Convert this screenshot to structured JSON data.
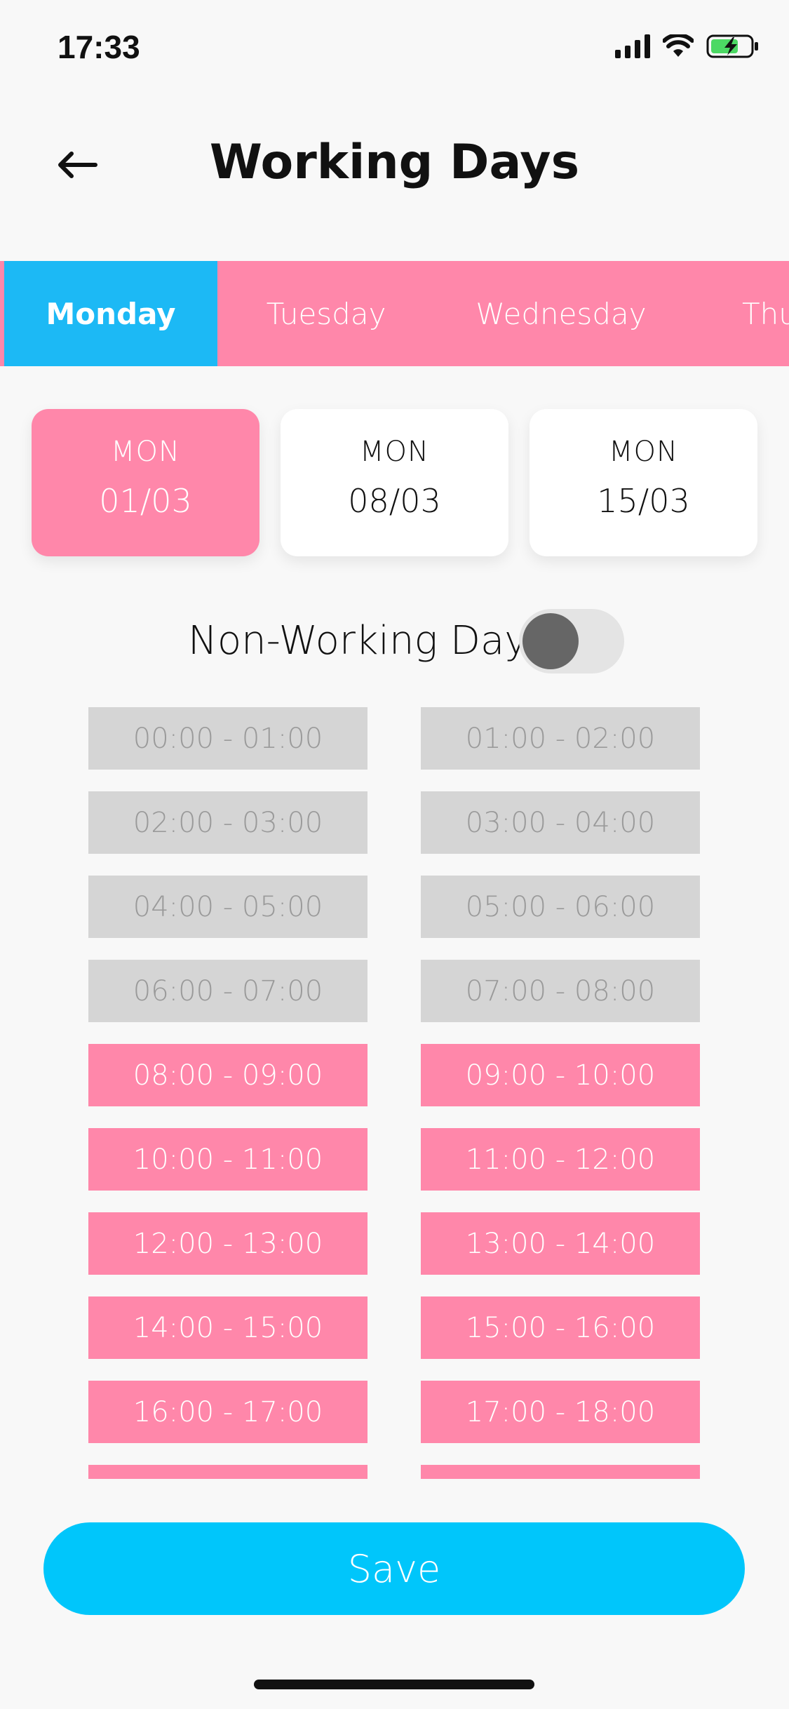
{
  "status_bar": {
    "time": "17:33"
  },
  "header": {
    "title": "Working Days",
    "back_icon": "arrow-left-icon"
  },
  "day_tabs": [
    {
      "label": "Monday",
      "active": true
    },
    {
      "label": "Tuesday",
      "active": false
    },
    {
      "label": "Wednesday",
      "active": false
    },
    {
      "label": "Thu",
      "active": false
    }
  ],
  "date_cards": [
    {
      "dow": "MON",
      "date": "01/03",
      "active": true
    },
    {
      "dow": "MON",
      "date": "08/03",
      "active": false
    },
    {
      "dow": "MON",
      "date": "15/03",
      "active": false
    }
  ],
  "non_working": {
    "label": "Non-Working Day",
    "enabled": false
  },
  "slots": [
    {
      "label": "00:00 - 01:00",
      "selected": false
    },
    {
      "label": "01:00 - 02:00",
      "selected": false
    },
    {
      "label": "02:00 - 03:00",
      "selected": false
    },
    {
      "label": "03:00 - 04:00",
      "selected": false
    },
    {
      "label": "04:00 - 05:00",
      "selected": false
    },
    {
      "label": "05:00 - 06:00",
      "selected": false
    },
    {
      "label": "06:00 - 07:00",
      "selected": false
    },
    {
      "label": "07:00 - 08:00",
      "selected": false
    },
    {
      "label": "08:00 - 09:00",
      "selected": true
    },
    {
      "label": "09:00 - 10:00",
      "selected": true
    },
    {
      "label": "10:00 - 11:00",
      "selected": true
    },
    {
      "label": "11:00 - 12:00",
      "selected": true
    },
    {
      "label": "12:00 - 13:00",
      "selected": true
    },
    {
      "label": "13:00 - 14:00",
      "selected": true
    },
    {
      "label": "14:00 - 15:00",
      "selected": true
    },
    {
      "label": "15:00 - 16:00",
      "selected": true
    },
    {
      "label": "16:00 - 17:00",
      "selected": true
    },
    {
      "label": "17:00 - 18:00",
      "selected": true
    },
    {
      "label": "",
      "selected": true
    },
    {
      "label": "",
      "selected": true
    }
  ],
  "save": {
    "label": "Save"
  },
  "colors": {
    "accent_pink": "#ff87aa",
    "accent_blue": "#1cb9f5",
    "save_blue": "#00c6fb",
    "slot_off": "#d5d5d5"
  }
}
